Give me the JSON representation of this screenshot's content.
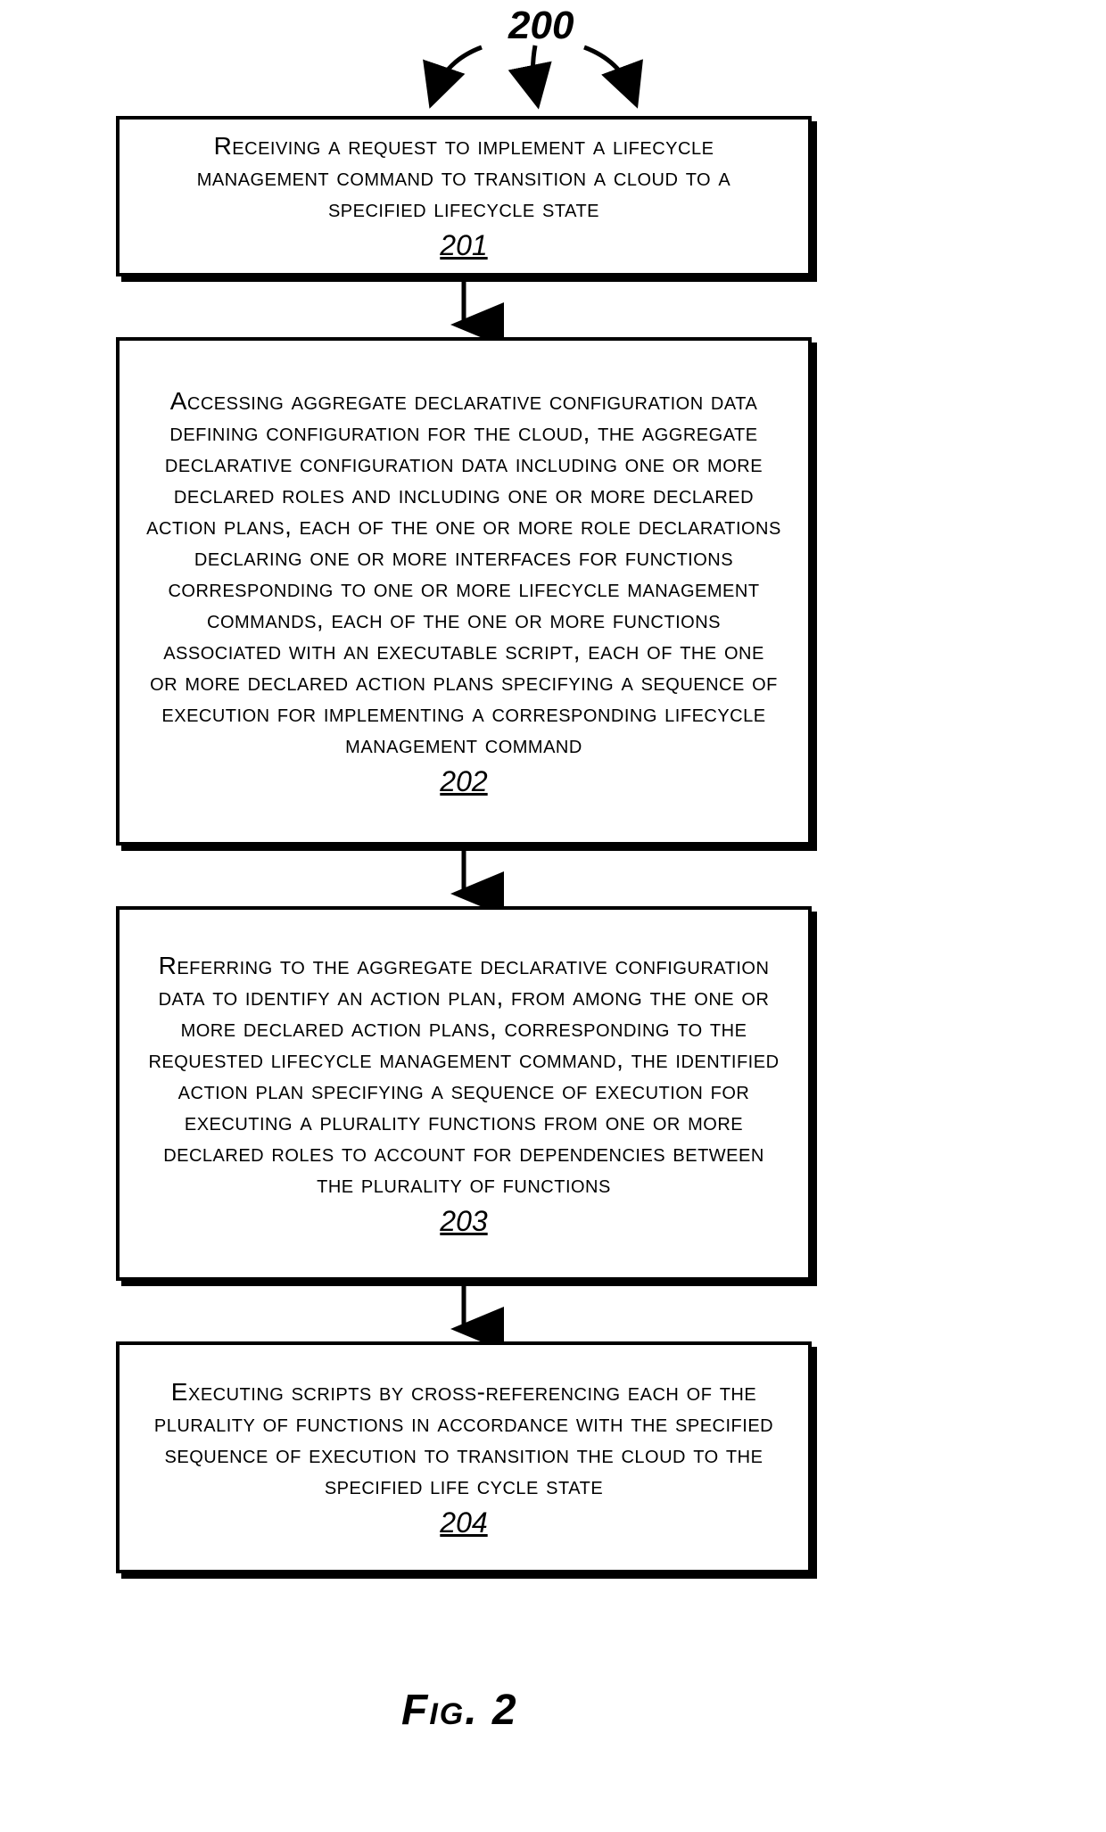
{
  "diagram": {
    "reference_number": "200",
    "figure_caption": "Fig. 2",
    "steps": [
      {
        "num": "201",
        "text": "Receiving a request to implement a lifecycle management command to transition a cloud to a specified lifecycle state"
      },
      {
        "num": "202",
        "text": "Accessing aggregate declarative configuration data defining configuration for the cloud, the aggregate declarative configuration data including one or more declared roles and including one or more declared action plans, each of the one or more role declarations declaring one or more interfaces for functions corresponding to one or more lifecycle management commands, each of the one or more functions associated with an executable script, each of the one or more declared action plans specifying a sequence of execution for implementing a corresponding lifecycle management command"
      },
      {
        "num": "203",
        "text": "Referring to the aggregate declarative configuration data to identify an action plan, from among the one or more declared action plans, corresponding to the requested lifecycle management command, the identified action plan specifying a sequence of execution for executing a plurality functions from one or more declared roles to account for dependencies between the plurality of functions"
      },
      {
        "num": "204",
        "text": "Executing scripts by cross-referencing each of the plurality of functions in accordance with the specified sequence of execution to transition the cloud to the specified life cycle state"
      }
    ]
  }
}
